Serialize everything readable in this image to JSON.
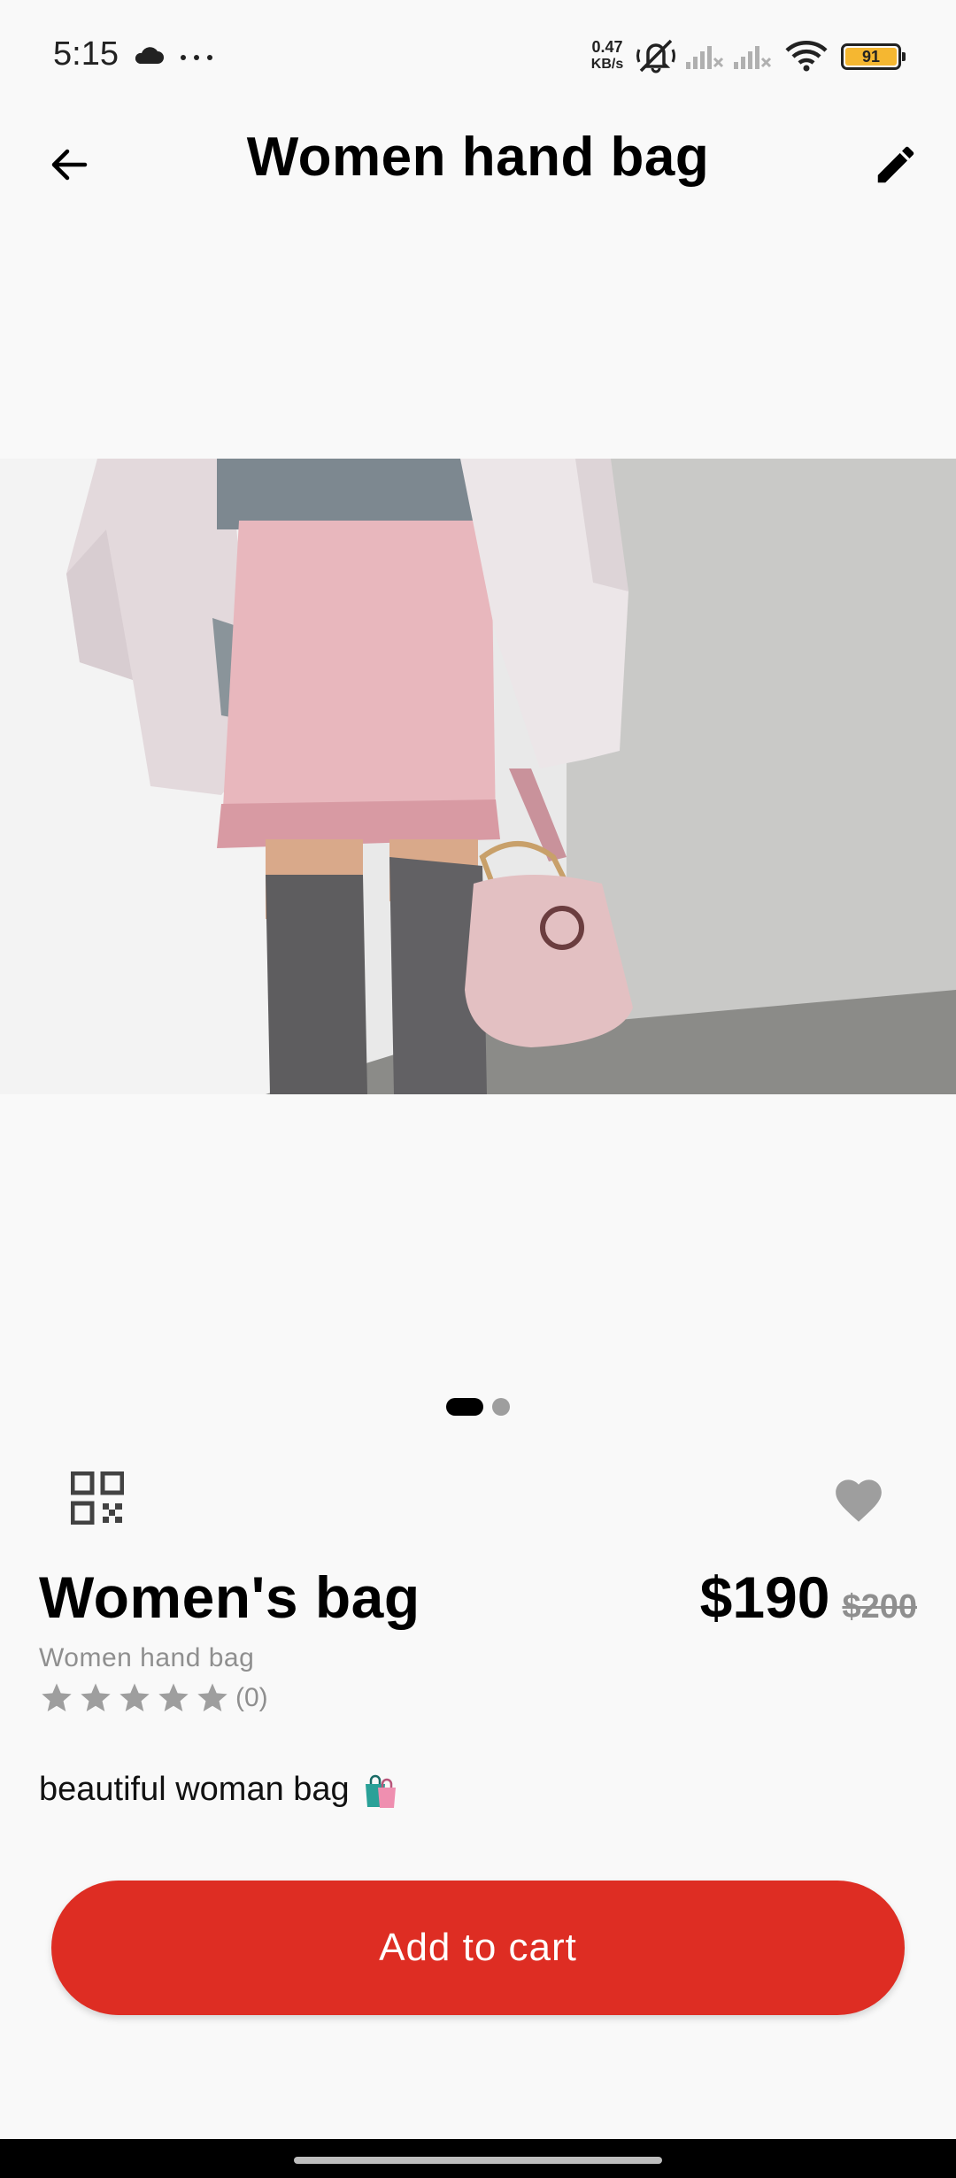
{
  "status_bar": {
    "time": "5:15",
    "net_speed_value": "0.47",
    "net_speed_unit": "KB/s",
    "battery_level": "91",
    "battery_color": "#f5b731"
  },
  "app_bar": {
    "title": "Women hand bag",
    "back_icon": "arrow-left-icon",
    "edit_icon": "pencil-icon"
  },
  "carousel": {
    "total_images": 2,
    "active_index": 0
  },
  "product": {
    "name": "Women's bag",
    "price": "$190",
    "old_price": "$200",
    "category": "Women hand bag",
    "rating_stars": 0,
    "rating_max": 5,
    "rating_count": "(0)",
    "description": "beautiful woman bag",
    "description_emoji": "shopping-bags-icon"
  },
  "actions": {
    "qr_icon": "qr-code-icon",
    "favorite_icon": "heart-icon",
    "add_to_cart_label": "Add to cart"
  },
  "colors": {
    "accent": "#de2d23",
    "muted": "#8f8f8f",
    "background": "#f9f9f9"
  }
}
